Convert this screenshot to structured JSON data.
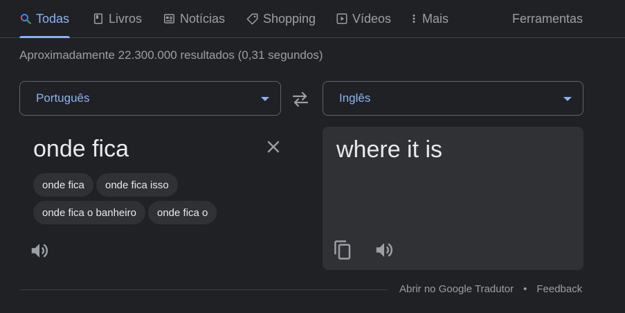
{
  "tabs": [
    {
      "label": "Todas",
      "icon": "search-icon",
      "active": true
    },
    {
      "label": "Livros",
      "icon": "book-icon"
    },
    {
      "label": "Notícias",
      "icon": "news-icon"
    },
    {
      "label": "Shopping",
      "icon": "tag-icon"
    },
    {
      "label": "Vídeos",
      "icon": "play-icon"
    },
    {
      "label": "Mais",
      "icon": "more-vert-icon"
    }
  ],
  "tools_label": "Ferramentas",
  "result_stats": "Aproximadamente 22.300.000 resultados (0,31 segundos)",
  "translator": {
    "source_language": "Português",
    "target_language": "Inglês",
    "source_text": "onde fica",
    "target_text": "where it is",
    "suggestions": [
      "onde fica",
      "onde fica isso",
      "onde fica o banheiro",
      "onde fica o"
    ]
  },
  "footer": {
    "open_translate": "Abrir no Google Tradutor",
    "separator": "•",
    "feedback": "Feedback"
  },
  "colors": {
    "accent": "#8ab4f8",
    "background": "#202124",
    "panel": "#303134"
  }
}
